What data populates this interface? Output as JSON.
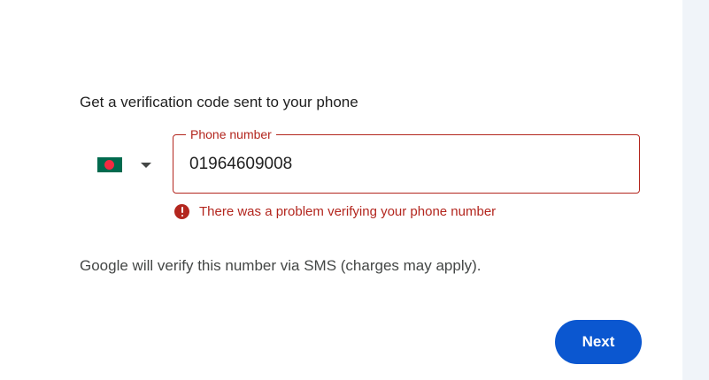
{
  "prompt": "Get a verification code sent to your phone",
  "country_picker": {
    "flag_icon": "bangladesh-flag-icon",
    "dropdown_icon": "chevron-down-icon"
  },
  "phone_field": {
    "label": "Phone number",
    "value": "01964609008"
  },
  "error": {
    "icon": "error-icon",
    "message": "There was a problem verifying your phone number"
  },
  "sms_note": "Google will verify this number via SMS (charges may apply).",
  "next_button": {
    "label": "Next"
  },
  "colors": {
    "accent": "#0b57d0",
    "error": "#b3261e",
    "flag_green": "#006a4e",
    "flag_red": "#f42a41",
    "side_panel": "#f0f4f9"
  }
}
